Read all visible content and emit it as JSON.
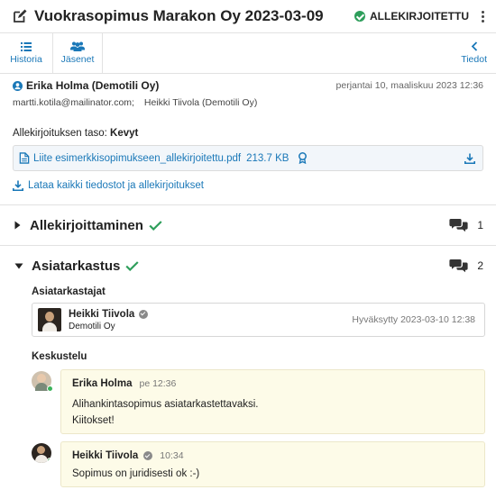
{
  "header": {
    "title": "Vuokrasopimus Marakon Oy 2023-03-09",
    "status": "ALLEKIRJOITETTU",
    "status_color": "#2e9e5b"
  },
  "toolbar": {
    "history": "Historia",
    "members": "Jäsenet",
    "details": "Tiedot",
    "accent_color": "#1a78b8"
  },
  "message": {
    "sender": "Erika Holma (Demotili Oy)",
    "date": "perjantai 10, maaliskuu 2023 12:36",
    "recipients": [
      "martti.kotila@mailinator.com;",
      "Heikki Tiivola (Demotili Oy)"
    ],
    "signature_level_label": "Allekirjoituksen taso:",
    "signature_level_value": "Kevyt",
    "attachment": {
      "name": "Liite esimerkkisopimukseen_allekirjoitettu.pdf",
      "size": "213.7 KB"
    },
    "download_all": "Lataa kaikki tiedostot ja allekirjoitukset"
  },
  "sections": [
    {
      "title": "Allekirjoittaminen",
      "comment_count": "1",
      "expanded": false
    },
    {
      "title": "Asiatarkastus",
      "comment_count": "2",
      "expanded": true
    }
  ],
  "review": {
    "reviewers_label": "Asiatarkastajat",
    "reviewer": {
      "name": "Heikki Tiivola",
      "org": "Demotili Oy",
      "status": "Hyväksytty 2023-03-10 12:38"
    },
    "discussion_label": "Keskustelu",
    "comments": [
      {
        "author": "Erika Holma",
        "time": "pe 12:36",
        "lines": [
          "Alihankintasopimus asiatarkastettavaksi.",
          "Kiitokset!"
        ]
      },
      {
        "author": "Heikki Tiivola",
        "time": "10:34",
        "lines": [
          "Sopimus on juridisesti ok :-)"
        ]
      }
    ]
  }
}
